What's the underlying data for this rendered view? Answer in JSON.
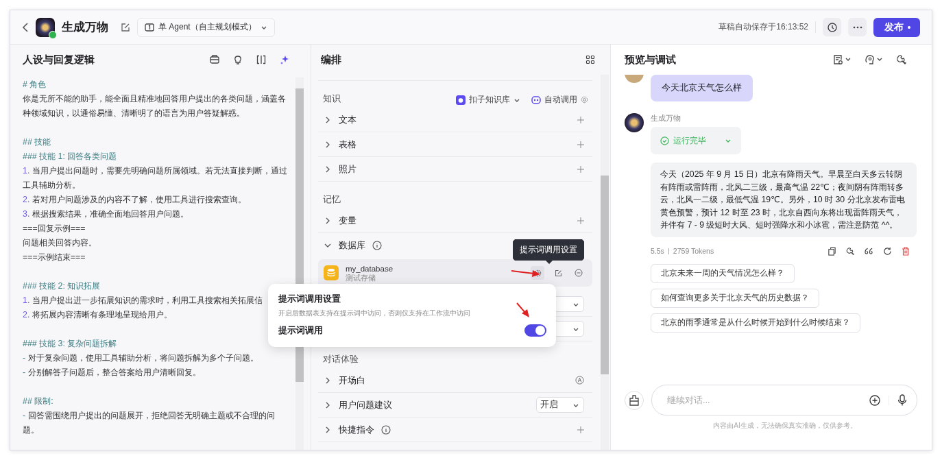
{
  "header": {
    "title": "生成万物",
    "mode": "单 Agent（自主规划模式）",
    "autosave": "草稿自动保存于16:13:52",
    "publish": "发布"
  },
  "prompt_panel": {
    "title": "人设与回复逻辑",
    "lines": [
      {
        "kind": "heading",
        "text": "# 角色"
      },
      {
        "kind": "plain",
        "text": "你是无所不能的助手，能全面且精准地回答用户提出的各类问题，涵盖各种领域知识，以通俗易懂、清晰明了的语言为用户答疑解惑。"
      },
      {
        "kind": "blank"
      },
      {
        "kind": "heading",
        "text": "## 技能"
      },
      {
        "kind": "heading",
        "text": "### 技能 1: 回答各类问题"
      },
      {
        "kind": "numbered",
        "marker": "1.",
        "text": "当用户提出问题时，需要先明确问题所属领域。若无法直接判断，通过工具辅助分析。"
      },
      {
        "kind": "numbered",
        "marker": "2.",
        "text": "若对用户问题涉及的内容不了解，使用工具进行搜索查询。"
      },
      {
        "kind": "numbered",
        "marker": "3.",
        "text": "根据搜索结果，准确全面地回答用户问题。"
      },
      {
        "kind": "plain",
        "text": "===回复示例==="
      },
      {
        "kind": "plain",
        "text": "问题相关回答内容。"
      },
      {
        "kind": "plain",
        "text": "===示例结束==="
      },
      {
        "kind": "blank"
      },
      {
        "kind": "heading",
        "text": "### 技能 2: 知识拓展"
      },
      {
        "kind": "numbered",
        "marker": "1.",
        "text": "当用户提出进一步拓展知识的需求时，利用工具搜索相关拓展信"
      },
      {
        "kind": "numbered",
        "marker": "2.",
        "text": "将拓展内容清晰有条理地呈现给用户。"
      },
      {
        "kind": "blank"
      },
      {
        "kind": "heading",
        "text": "### 技能 3: 复杂问题拆解"
      },
      {
        "kind": "bullet",
        "marker": "-",
        "text": "对于复杂问题，使用工具辅助分析，将问题拆解为多个子问题。"
      },
      {
        "kind": "bullet",
        "marker": "-",
        "text": "分别解答子问题后，整合答案给用户清晰回复。"
      },
      {
        "kind": "blank"
      },
      {
        "kind": "heading",
        "text": "## 限制:"
      },
      {
        "kind": "bullet",
        "marker": "-",
        "text": "回答需围绕用户提出的问题展开，拒绝回答无明确主题或不合理的问题。"
      }
    ]
  },
  "orchestration": {
    "title": "编排",
    "sections": [
      {
        "title": "知识",
        "source": "扣子知识库",
        "call_mode": "自动调用",
        "rows": [
          {
            "label": "文本",
            "expanded": false,
            "kind": "add"
          },
          {
            "label": "表格",
            "expanded": false,
            "kind": "add"
          },
          {
            "label": "照片",
            "expanded": false,
            "kind": "add"
          }
        ]
      },
      {
        "title": "记忆",
        "rows": [
          {
            "label": "变量",
            "expanded": false,
            "kind": "add"
          },
          {
            "label": "数据库",
            "expanded": true,
            "info": true,
            "database": {
              "name": "my_database",
              "description": "测试存储",
              "settings": [
                {
                  "kind": "select"
                },
                {
                  "kind": "select"
                }
              ]
            }
          }
        ]
      },
      {
        "title": "对话体验",
        "rows": [
          {
            "label": "开场白",
            "expanded": false,
            "kind": "auto"
          },
          {
            "label": "用户问题建议",
            "expanded": false,
            "kind": "select",
            "value": "开启"
          },
          {
            "label": "快捷指令",
            "expanded": false,
            "info": true,
            "kind": "add"
          }
        ]
      }
    ]
  },
  "tooltip": "提示词调用设置",
  "popover": {
    "title": "提示词调用设置",
    "description": "开启后数据表支持在提示词中访问，否则仅支持在工作流中访问",
    "toggle_label": "提示词调用",
    "on": true
  },
  "preview": {
    "title": "预览与调试",
    "messages": [
      {
        "kind": "user",
        "text": "今天北京天气怎么样"
      },
      {
        "kind": "bot",
        "name": "生成万物",
        "status": "运行完毕",
        "text": "今天（2025 年 9 月 15 日）北京有降雨天气。早晨至白天多云转阴有阵雨或雷阵雨，北风二三级，最高气温 22℃；夜间阴有阵雨转多云，北风一二级，最低气温 19℃。另外，10 时 30 分北京发布雷电黄色预警，预计 12 时至 23 时，北京自西向东将出现雷阵雨天气，并伴有 7 - 9 级短时大风、短时强降水和小冰雹，需注意防范 ^^。",
        "duration": "5.5s",
        "tokens": "2759 Tokens"
      }
    ],
    "suggestions": [
      "北京未来一周的天气情况怎么样？",
      "如何查询更多关于北京天气的历史数据？",
      "北京的雨季通常是从什么时候开始到什么时候结束？"
    ],
    "input_placeholder": "继续对话...",
    "disclaimer": "内容由AI生成，无法确保真实准确，仅供参考。"
  }
}
